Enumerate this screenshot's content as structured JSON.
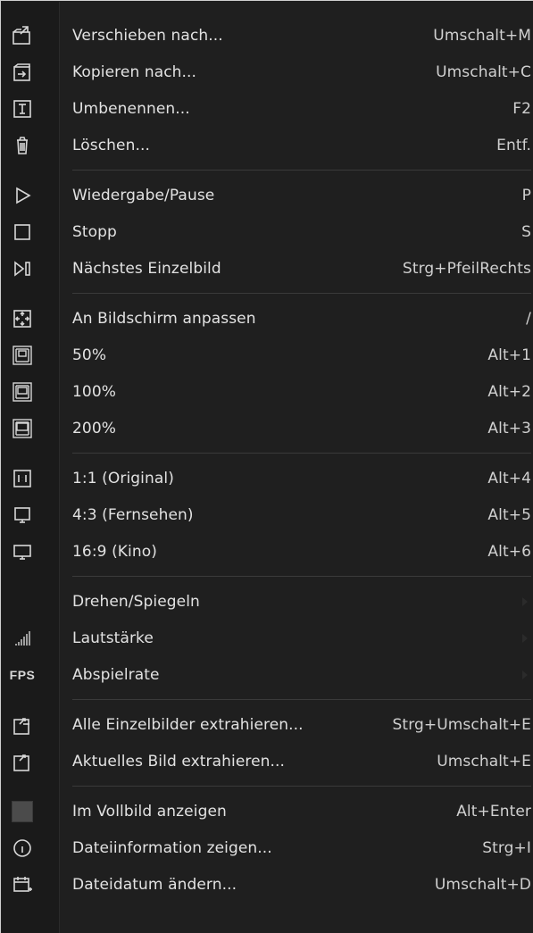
{
  "menu": {
    "items": [
      {
        "label": "Verschieben nach...",
        "shortcut": "Umschalt+M",
        "icon": "move-to-icon"
      },
      {
        "label": "Kopieren nach...",
        "shortcut": "Umschalt+C",
        "icon": "copy-to-icon"
      },
      {
        "label": "Umbenennen...",
        "shortcut": "F2",
        "icon": "rename-icon"
      },
      {
        "label": "Löschen...",
        "shortcut": "Entf.",
        "icon": "delete-icon"
      },
      {
        "label": "Wiedergabe/Pause",
        "shortcut": "P",
        "icon": "play-icon"
      },
      {
        "label": "Stopp",
        "shortcut": "S",
        "icon": "stop-icon"
      },
      {
        "label": "Nächstes Einzelbild",
        "shortcut": "Strg+PfeilRechts",
        "icon": "next-frame-icon"
      },
      {
        "label": "An Bildschirm anpassen",
        "shortcut": "/",
        "icon": "fit-screen-icon"
      },
      {
        "label": "50%",
        "shortcut": "Alt+1",
        "icon": "zoom-50-icon"
      },
      {
        "label": "100%",
        "shortcut": "Alt+2",
        "icon": "zoom-100-icon"
      },
      {
        "label": "200%",
        "shortcut": "Alt+3",
        "icon": "zoom-200-icon"
      },
      {
        "label": "1:1 (Original)",
        "shortcut": "Alt+4",
        "icon": "aspect-original-icon"
      },
      {
        "label": "4:3 (Fernsehen)",
        "shortcut": "Alt+5",
        "icon": "aspect-43-icon"
      },
      {
        "label": "16:9 (Kino)",
        "shortcut": "Alt+6",
        "icon": "aspect-169-icon"
      },
      {
        "label": "Drehen/Spiegeln",
        "shortcut": "",
        "icon": "",
        "submenu": true
      },
      {
        "label": "Lautstärke",
        "shortcut": "",
        "icon": "volume-icon",
        "submenu": true
      },
      {
        "label": "Abspielrate",
        "shortcut": "",
        "icon": "fps-icon",
        "submenu": true
      },
      {
        "label": "Alle Einzelbilder extrahieren...",
        "shortcut": "Strg+Umschalt+E",
        "icon": "extract-all-frames-icon"
      },
      {
        "label": "Aktuelles Bild extrahieren...",
        "shortcut": "Umschalt+E",
        "icon": "extract-current-frame-icon"
      },
      {
        "label": "Im Vollbild anzeigen",
        "shortcut": "Alt+Enter",
        "icon": "fullscreen-icon"
      },
      {
        "label": "Dateiinformation zeigen...",
        "shortcut": "Strg+I",
        "icon": "info-icon"
      },
      {
        "label": "Dateidatum ändern...",
        "shortcut": "Umschalt+D",
        "icon": "change-date-icon"
      }
    ],
    "fps_icon_text": "FPS"
  },
  "colors": {
    "background": "#1f1f1f",
    "text": "#e2e2e2",
    "separator": "#3a3a3a",
    "border": "#cfcfcf"
  }
}
